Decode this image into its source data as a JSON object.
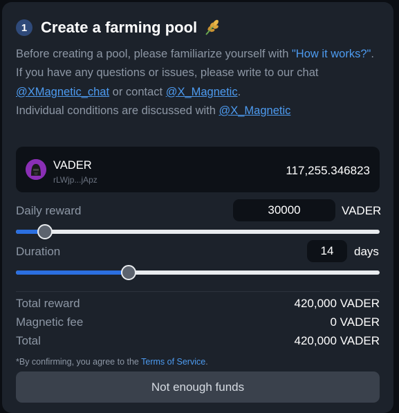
{
  "header": {
    "step_number": "1",
    "title": "Create a farming pool",
    "icon": "wheat-icon"
  },
  "intro": {
    "line1_text": "Before creating a pool, please familiarize yourself with ",
    "how_it_works_link": "\"How it works?\"",
    "line1_end": ".",
    "line2_text": "If you have any questions or issues, please write to our chat ",
    "chat_link": "@XMagnetic_chat",
    "or_contact": " or contact ",
    "contact_link": "@X_Magnetic",
    "line2_end": ".",
    "line3_text": "Individual conditions are discussed with ",
    "conditions_link": "@X_Magnetic"
  },
  "token": {
    "name": "VADER",
    "address": "rLWjp...jApz",
    "balance": "117,255.346823",
    "avatar_icon": "vader-avatar-icon"
  },
  "daily_reward": {
    "label": "Daily reward",
    "value": "30000",
    "unit": "VADER",
    "slider_fraction": 0.08
  },
  "duration": {
    "label": "Duration",
    "value": "14",
    "unit": "days",
    "slider_fraction": 0.31
  },
  "summary": {
    "total_reward_label": "Total reward",
    "total_reward_value": "420,000 VADER",
    "magnetic_fee_label": "Magnetic fee",
    "magnetic_fee_value": "0 VADER",
    "total_label": "Total",
    "total_value": "420,000 VADER"
  },
  "disclaimer": {
    "text": "*By confirming, you agree to the ",
    "terms_link": "Terms of Service",
    "end": "."
  },
  "submit": {
    "label": "Not enough funds"
  },
  "colors": {
    "card_bg": "#1c222b",
    "accent": "#2b6fe0",
    "link": "#4d9bf0"
  }
}
